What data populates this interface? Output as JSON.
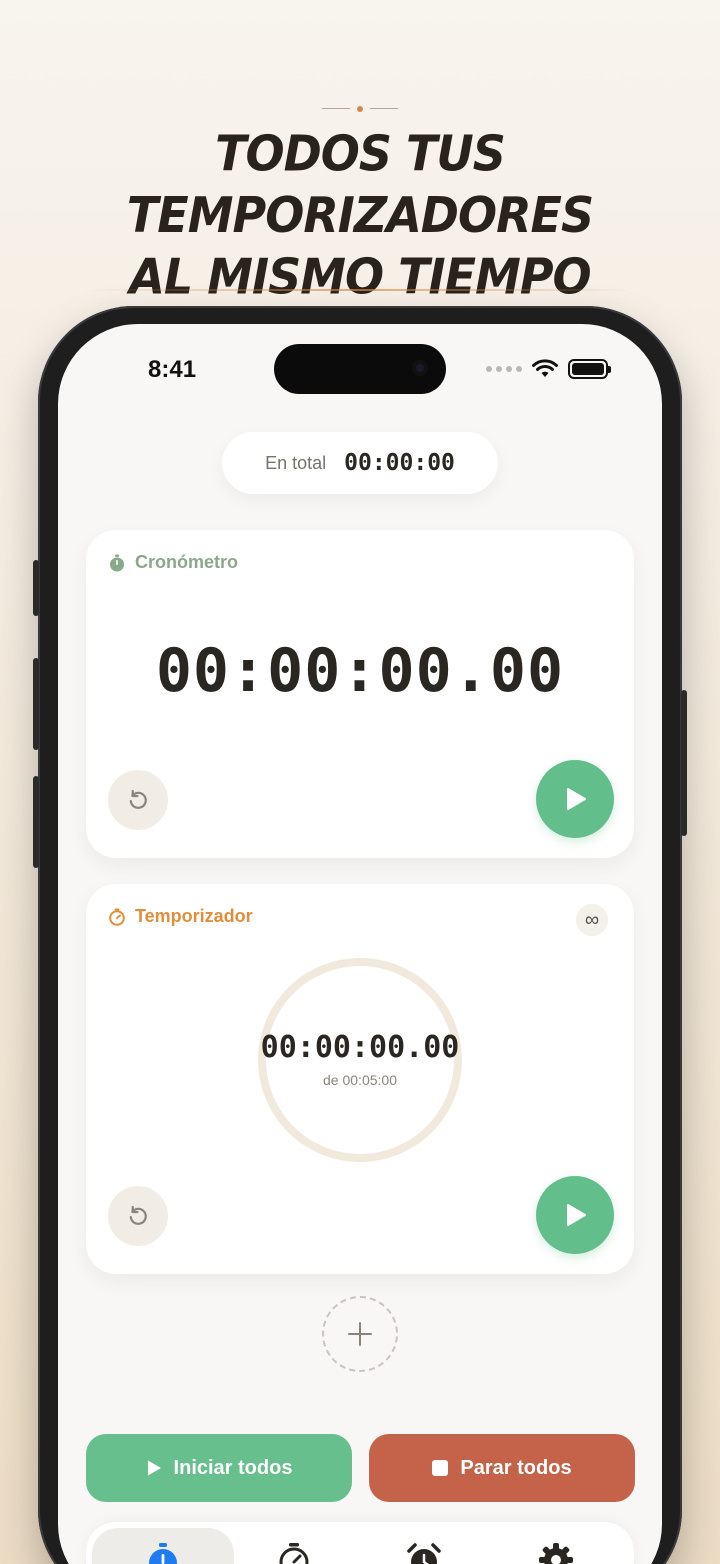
{
  "headline": {
    "line1": "TODOS TUS TEMPORIZADORES",
    "line2": "AL MISMO TIEMPO"
  },
  "status_bar": {
    "time": "8:41"
  },
  "total": {
    "label": "En total",
    "value": "00:00:00"
  },
  "stopwatch_card": {
    "title": "Cronómetro",
    "time": "00:00:00.00"
  },
  "timer_card": {
    "title": "Temporizador",
    "time": "00:00:00.00",
    "of_label": "de 00:05:00",
    "repeat_symbol": "∞"
  },
  "actions": {
    "start_all": "Iniciar todos",
    "stop_all": "Parar todos"
  },
  "tabs": [
    {
      "icon": "stopwatch-icon",
      "active": true
    },
    {
      "icon": "timer-icon",
      "active": false
    },
    {
      "icon": "alarm-clock-icon",
      "active": false
    },
    {
      "icon": "gear-icon",
      "active": false
    }
  ],
  "colors": {
    "accent_green": "#62bf8c",
    "stop_red": "#c4624a",
    "timer_orange": "#e08e3c",
    "stopwatch_green": "#8aa88a",
    "active_tab_blue": "#1d7cf2"
  }
}
